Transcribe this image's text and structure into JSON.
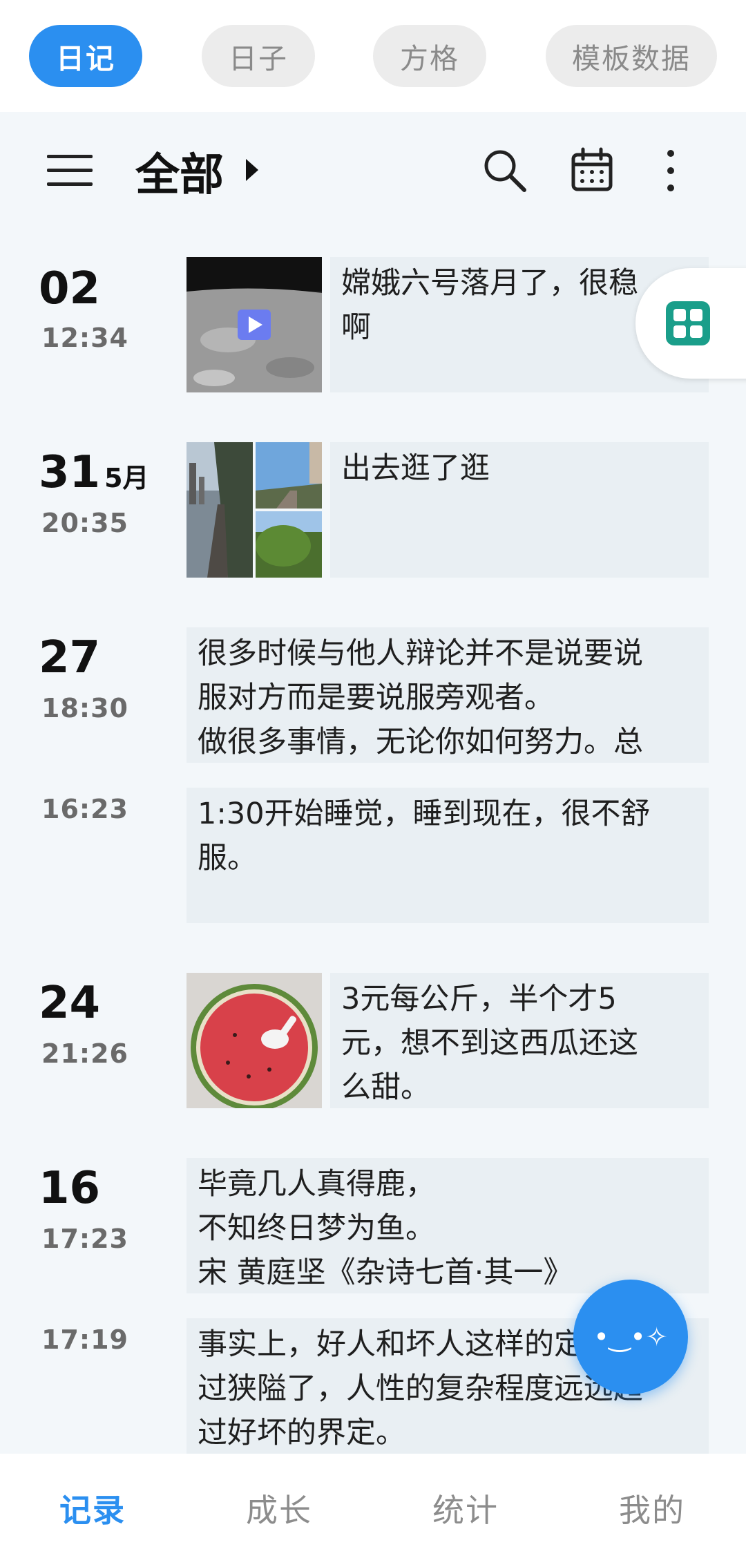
{
  "top_tabs": [
    {
      "label": "日记",
      "active": true
    },
    {
      "label": "日子",
      "active": false
    },
    {
      "label": "方格",
      "active": false
    },
    {
      "label": "模板数据",
      "active": false
    }
  ],
  "header": {
    "title": "全部",
    "icons": [
      "menu-icon",
      "search-icon",
      "calendar-icon",
      "more-vertical-icon"
    ]
  },
  "entries": [
    {
      "day": "02",
      "month": "",
      "time": "12:34",
      "text": "嫦娥六号落月了，很稳\n啊",
      "thumb": "moon-landing-video"
    },
    {
      "day": "31",
      "month": "5月",
      "time": "20:35",
      "text": "出去逛了逛",
      "thumb": "railway-photos"
    },
    {
      "day": "27",
      "month": "",
      "time": "18:30",
      "text": "很多时候与他人辩论并不是说要说\n服对方而是要说服旁观者。\n做很多事情，无论你如何努力。总",
      "thumb": ""
    },
    {
      "day": "",
      "month": "",
      "time": "16:23",
      "text": "1:30开始睡觉，睡到现在，很不舒\n服。",
      "thumb": ""
    },
    {
      "day": "24",
      "month": "",
      "time": "21:26",
      "text": "3元每公斤，半个才5\n元，想不到这西瓜还这\n么甜。",
      "thumb": "watermelon-photo"
    },
    {
      "day": "16",
      "month": "",
      "time": "17:23",
      "text": "毕竟几人真得鹿，\n不知终日梦为鱼。\n宋 黄庭坚《杂诗七首·其一》",
      "thumb": ""
    },
    {
      "day": "",
      "month": "",
      "time": "17:19",
      "text": "事实上，好人和坏人这样的定义太\n过狭隘了，人性的复杂程度远远超\n过好坏的界定。",
      "thumb": ""
    }
  ],
  "side_widget": {
    "icon": "grid-apps-icon"
  },
  "fab": {
    "label": "•‿•✧",
    "icon": "smiley-face-icon"
  },
  "bottom_nav": [
    {
      "label": "记录",
      "active": true
    },
    {
      "label": "成长",
      "active": false
    },
    {
      "label": "统计",
      "active": false
    },
    {
      "label": "我的",
      "active": false
    }
  ],
  "colors": {
    "accent": "#2b8ff0",
    "background": "#f3f7fa",
    "card": "#e9eff3"
  }
}
